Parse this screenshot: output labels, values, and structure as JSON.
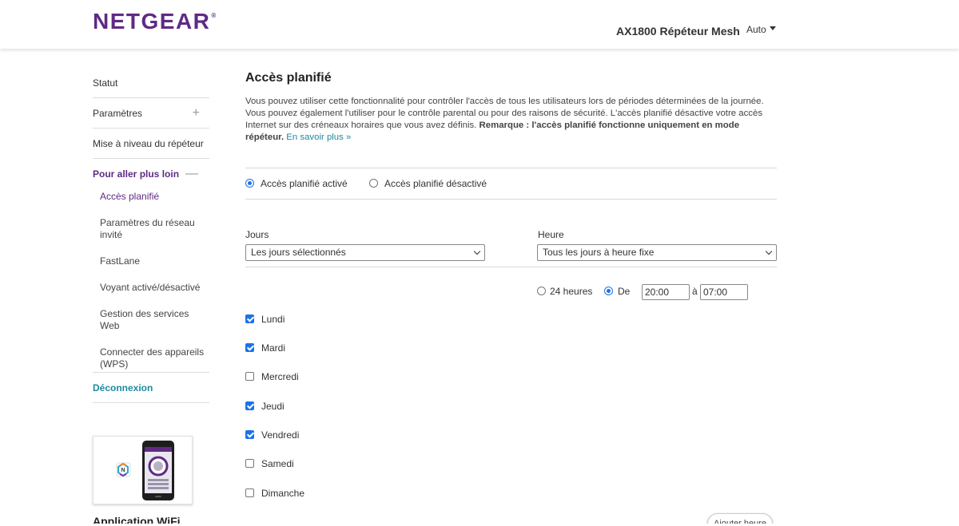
{
  "header": {
    "logo": "NETGEAR",
    "logo_mark": "®",
    "product": "AX1800 Répéteur Mesh",
    "language": "Auto"
  },
  "sidebar": {
    "items": [
      {
        "label": "Statut"
      },
      {
        "label": "Paramètres",
        "expander": "+"
      },
      {
        "label": "Mise à niveau du répéteur"
      },
      {
        "label": "Pour aller plus loin",
        "expander": "—"
      }
    ],
    "sub_items": [
      {
        "label": "Accès planifié"
      },
      {
        "label": "Paramètres du réseau invité"
      },
      {
        "label": "FastLane"
      },
      {
        "label": "Voyant activé/désactivé"
      },
      {
        "label": "Gestion des services Web"
      },
      {
        "label": "Connecter des appareils (WPS)"
      }
    ],
    "logout": "Déconnexion",
    "app_title": "Application WiFi"
  },
  "main": {
    "title": "Accès planifié",
    "desc_text": "Vous pouvez utiliser cette fonctionnalité pour contrôler l'accès de tous les utilisateurs lors de périodes déterminées de la journée. Vous pouvez également l'utiliser pour le contrôle parental ou pour des raisons de sécurité. L'accès planifié désactive votre accès Internet sur des créneaux horaires que vous avez définis. ",
    "desc_bold": "Remarque : l'accès planifié fonctionne uniquement en mode répéteur.",
    "desc_link": "En savoir plus »",
    "mode_on": "Accès planifié activé",
    "mode_off": "Accès planifié désactivé",
    "days_label": "Jours",
    "days_value": "Les jours sélectionnés",
    "time_label": "Heure",
    "time_value": "Tous les jours à heure fixe",
    "opt_24h": "24 heures",
    "opt_from": "De",
    "from_value": "20:00",
    "to_label": "à",
    "to_value": "07:00",
    "days": [
      {
        "label": "Lundi",
        "checked": true
      },
      {
        "label": "Mardi",
        "checked": true
      },
      {
        "label": "Mercredi",
        "checked": false
      },
      {
        "label": "Jeudi",
        "checked": true
      },
      {
        "label": "Vendredi",
        "checked": true
      },
      {
        "label": "Samedi",
        "checked": false
      },
      {
        "label": "Dimanche",
        "checked": false
      }
    ],
    "add_button": "Ajouter heure"
  },
  "colors": {
    "brand": "#5f2a84",
    "link": "#1e8aa0",
    "control": "#1a73e8"
  }
}
